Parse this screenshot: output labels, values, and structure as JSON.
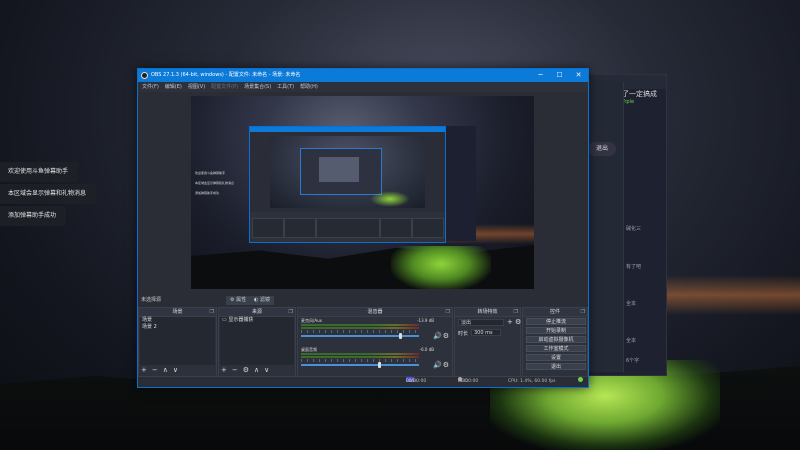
{
  "notifications": [
    "欢迎使用斗鱼弹幕助手",
    "本区域会显示弹幕和礼物消息",
    "添加弹幕助手成功"
  ],
  "bg_app": {
    "title": "了一定搞成",
    "subtitle": "Trple",
    "pill": "退出",
    "side_items": [
      "碱化三",
      "有了吧",
      "全本",
      "全本",
      "6个字"
    ]
  },
  "obs": {
    "title": "OBS 27.1.3 (64-bit, windows) - 配置文件: 未命名 - 场景: 未命名",
    "menu": [
      "文件(F)",
      "编辑(E)",
      "视图(V)",
      "配置文件(P)",
      "场景集合(S)",
      "工具(T)",
      "帮助(H)"
    ],
    "preview_text": [
      "欢迎使用斗鱼弹幕助手",
      "本区域会显示弹幕和礼物消息",
      "添加弹幕助手成功"
    ],
    "no_source": "未选择源",
    "props_btn": "属性",
    "filters_btn": "滤镜",
    "docks": {
      "scenes": {
        "title": "场景",
        "items": [
          "场景",
          "场景 2"
        ]
      },
      "sources": {
        "title": "来源",
        "items": [
          "显示器捕获"
        ]
      },
      "mixer": {
        "title": "混音器",
        "channels": [
          {
            "name": "麦克风/Aux",
            "db": "-13.9 dB",
            "level": 0.83
          },
          {
            "name": "桌面音频",
            "db": "-6.0 dB",
            "level": 0.65
          }
        ]
      },
      "transitions": {
        "title": "转场特效",
        "selected": "淡出",
        "duration_label": "时长",
        "duration": "300 ms"
      },
      "controls": {
        "title": "控件",
        "buttons": [
          "停止推流",
          "开始录制",
          "启动虚拟摄像机",
          "工作室模式",
          "设置",
          "退出"
        ]
      }
    },
    "status": {
      "live_label": "LIVE:",
      "live_time": "00:00:00",
      "rec_label": "REC:",
      "rec_time": "00:00:00",
      "cpu": "CPU: 1.4%, 60.00 fps"
    }
  }
}
